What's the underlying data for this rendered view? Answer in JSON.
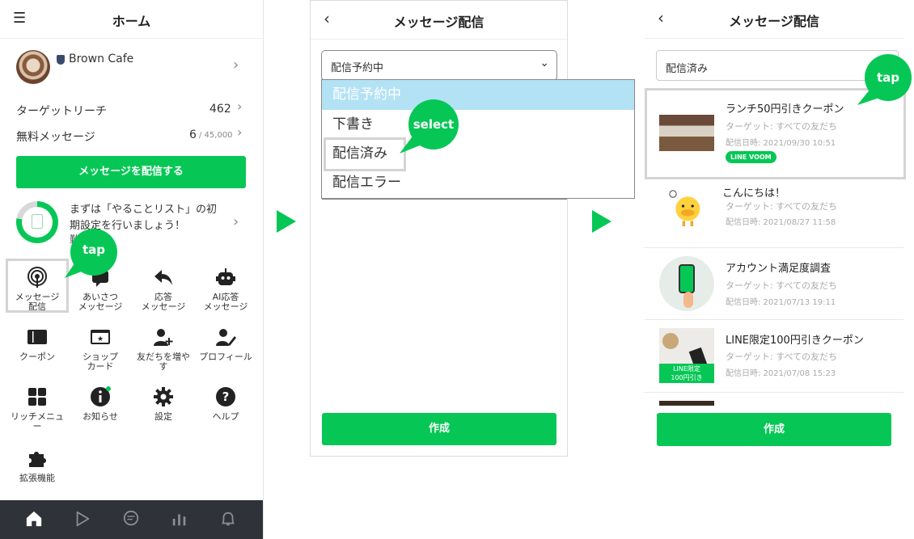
{
  "panel_home": {
    "title": "ホーム",
    "account_name": "Brown Cafe",
    "target_reach_label": "ターゲットリーチ",
    "target_reach_value": "462",
    "free_msg_label": "無料メッセージ",
    "free_msg_value": "6",
    "free_msg_limit": "/ 45,000",
    "broadcast_button": "メッセージを配信する",
    "todo_line1": "まずは「やることリスト」の初",
    "todo_line2": "期設定を行いましょう！",
    "todo_line3": "勤　ップ",
    "tap_label": "tap",
    "grid": [
      {
        "label": "メッセージ\n配信",
        "icon": "broadcast-icon"
      },
      {
        "label": "あいさつ\nメッセージ",
        "icon": "chat-icon"
      },
      {
        "label": "応答\nメッセージ",
        "icon": "reply-icon"
      },
      {
        "label": "AI応答\nメッセージ",
        "icon": "robot-icon"
      },
      {
        "label": "クーポン",
        "icon": "coupon-icon"
      },
      {
        "label": "ショップ\nカード",
        "icon": "card-icon"
      },
      {
        "label": "友だちを増や\nす",
        "icon": "add-friend-icon"
      },
      {
        "label": "プロフィール",
        "icon": "profile-edit-icon"
      },
      {
        "label": "リッチメニュ\nー",
        "icon": "grid-icon"
      },
      {
        "label": "お知らせ",
        "icon": "info-icon"
      },
      {
        "label": "設定",
        "icon": "gear-icon"
      },
      {
        "label": "ヘルプ",
        "icon": "help-icon"
      },
      {
        "label": "拡張機能",
        "icon": "puzzle-icon"
      }
    ]
  },
  "panel_select": {
    "title": "メッセージ配信",
    "dropdown_value": "配信予約中",
    "options": [
      "配信予約中",
      "下書き",
      "配信済み",
      "配信エラー"
    ],
    "select_label": "select",
    "create_button": "作成"
  },
  "panel_list": {
    "title": "メッセージ配信",
    "filter_value": "配信済み",
    "tap_label": "tap",
    "create_button": "作成",
    "items": [
      {
        "title": "ランチ50円引きクーポン",
        "target": "ターゲット: すべての友だち",
        "date": "配信日時: 2021/09/30 10:51",
        "badge": "LINE VOOM"
      },
      {
        "title": "こんにちは！",
        "target": "ターゲット: すべての友だち",
        "date": "配信日時: 2021/08/27 11:58"
      },
      {
        "title": "アカウント満足度調査",
        "target": "ターゲット: すべての友だち",
        "date": "配信日時: 2021/07/13 19:11"
      },
      {
        "title": "LINE限定100円引きクーポン",
        "target": "ターゲット: すべての友だち",
        "date": "配信日時: 2021/07/08 15:23",
        "thumb_text": "LINE限定\n100円引き"
      }
    ]
  },
  "colors": {
    "accent": "#06c755",
    "nav_bg": "#2f3238",
    "highlight_option": "#b3e2f5"
  }
}
